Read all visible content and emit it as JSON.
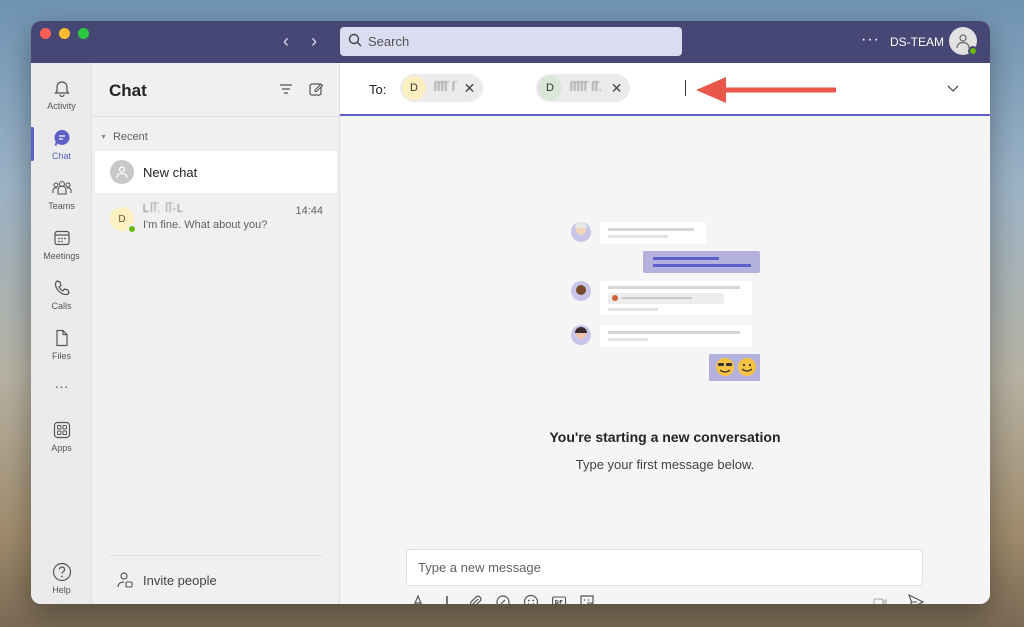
{
  "titlebar": {
    "search_placeholder": "Search",
    "more_label": "···",
    "team_name": "DS-TEAM",
    "back_arrow": "‹",
    "forward_arrow": "›"
  },
  "rail": {
    "items": [
      {
        "label": "Activity",
        "icon": "bell-icon"
      },
      {
        "label": "Chat",
        "icon": "chat-icon"
      },
      {
        "label": "Teams",
        "icon": "teams-icon"
      },
      {
        "label": "Meetings",
        "icon": "calendar-icon"
      },
      {
        "label": "Calls",
        "icon": "phone-icon"
      },
      {
        "label": "Files",
        "icon": "file-icon"
      },
      {
        "label": "",
        "icon": "more-apps-icon"
      },
      {
        "label": "Apps",
        "icon": "apps-icon"
      },
      {
        "label": "Help",
        "icon": "help-icon"
      }
    ],
    "more_dots": "···"
  },
  "chat_list": {
    "title": "Chat",
    "section_label": "Recent",
    "new_chat_label": "New chat",
    "conversation": {
      "avatar_initial": "D",
      "name": "Ꮮᥬᥬ. ᥬᥬ-Ꮮ",
      "preview": "I'm fine. What about you?",
      "time": "14:44"
    },
    "invite_label": "Invite people"
  },
  "to_bar": {
    "label": "To:",
    "recipients": [
      {
        "initial": "D",
        "name": "ᥬᥬᥬᥬ ᥬ",
        "avatar_color": "#fcefc0"
      },
      {
        "initial": "D",
        "name": "ᥬᥬᥬᥬᥬ ᥬᥬ.",
        "avatar_color": "#d9e6d8"
      }
    ],
    "remove_glyph": "✕"
  },
  "empty_state": {
    "heading": "You're starting a new conversation",
    "subheading": "Type your first message below."
  },
  "composer": {
    "placeholder": "Type a new message"
  },
  "colors": {
    "titlebar": "#464775",
    "accent": "#5b5fc7",
    "arrow": "#e8574a",
    "presence": "#6bb700"
  }
}
